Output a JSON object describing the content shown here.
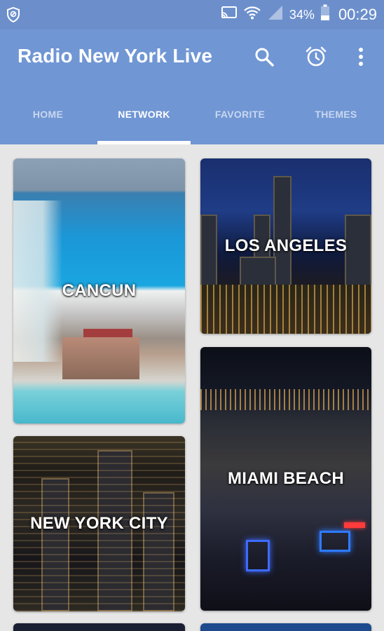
{
  "status_bar": {
    "battery_percent": "34%",
    "time": "00:29"
  },
  "app_bar": {
    "title": "Radio New York Live",
    "actions": {
      "search_icon": "search-icon",
      "alarm_icon": "alarm-icon",
      "more_icon": "more-vert-icon"
    }
  },
  "tabs": [
    {
      "label": "HOME",
      "active": false
    },
    {
      "label": "NETWORK",
      "active": true
    },
    {
      "label": "FAVORITE",
      "active": false
    },
    {
      "label": "THEMES",
      "active": false
    }
  ],
  "cards": [
    {
      "label": "CANCUN"
    },
    {
      "label": "LOS ANGELES"
    },
    {
      "label": "MIAMI BEACH"
    },
    {
      "label": "NEW YORK CITY"
    }
  ],
  "colors": {
    "primary": "#7096d4",
    "status_bar": "#6c8fcc",
    "background": "#e6e6e6"
  }
}
